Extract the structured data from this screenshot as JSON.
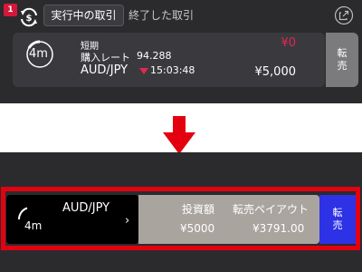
{
  "tabs": {
    "badge_count": "1",
    "active_label": "実行中の取引",
    "closed_label": "終了した取引"
  },
  "icons": {
    "app": "exchange-currency-icon",
    "external": "external-link-icon",
    "timer": "countdown-timer-icon",
    "arrow": "down-arrow-icon"
  },
  "trade_card": {
    "timer": "4m",
    "type": "短期",
    "rate_label": "購入レート",
    "rate_value": "94.288",
    "pair": "AUD/JPY",
    "time": "15:03:48",
    "payout": "¥0",
    "amount": "¥5,000",
    "resell_line1": "転",
    "resell_line2": "売"
  },
  "new_card": {
    "timer": "4m",
    "pair": "AUD/JPY",
    "chevron": "›",
    "investment_label": "投資額",
    "investment_value": "¥5000",
    "payout_label": "転売ペイアウト",
    "payout_value": "¥3791.00",
    "resell_line1": "転",
    "resell_line2": "売"
  },
  "colors": {
    "background": "#2b2b2e",
    "badge": "#d5183a",
    "loss_red": "#e02850",
    "highlight_red": "#e3000f",
    "resell_blue": "#2d32e6",
    "resell_gray": "#7b7b7e",
    "card_gray": "#aaa49f"
  }
}
